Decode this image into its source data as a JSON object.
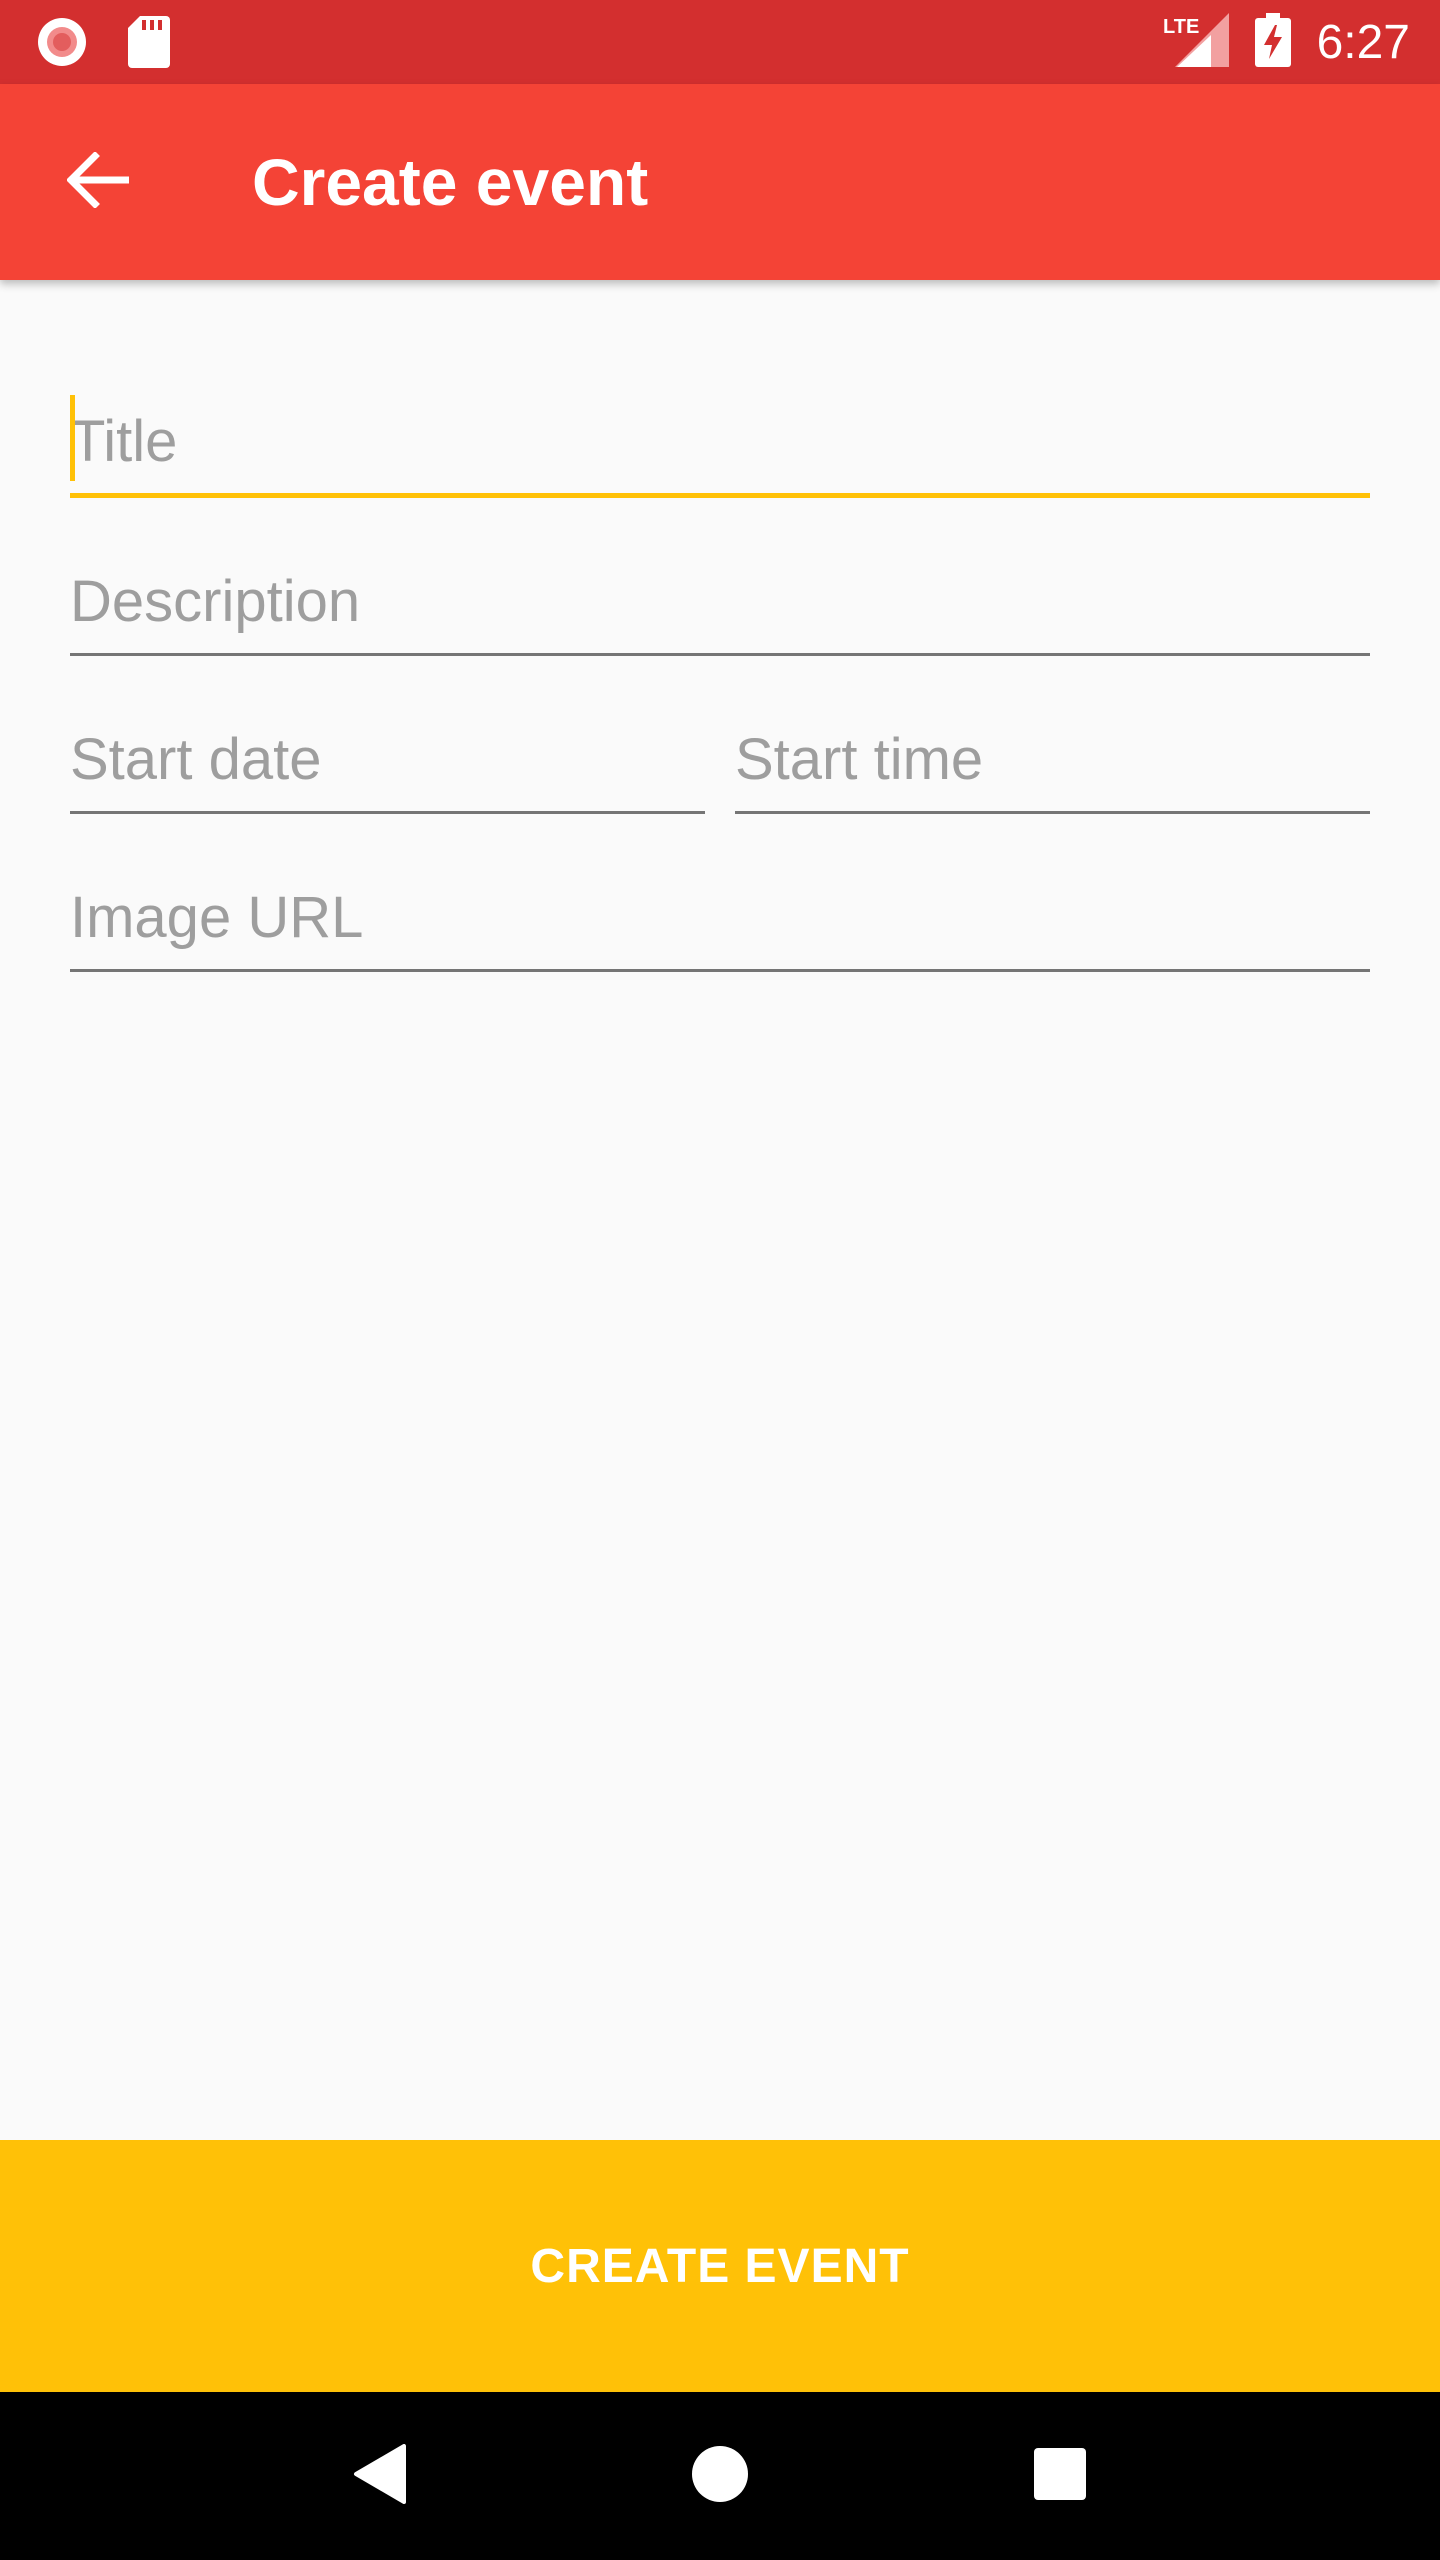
{
  "status_bar": {
    "time": "6:27",
    "network": "LTE",
    "left_icons": [
      "record-icon",
      "sd-card-icon"
    ],
    "right_icons": [
      "lte-signal-icon",
      "battery-charging-icon"
    ]
  },
  "app_bar": {
    "title": "Create event",
    "back_icon": "arrow-back-icon",
    "color": "#f44336"
  },
  "form": {
    "title_placeholder": "Title",
    "description_placeholder": "Description",
    "start_date_placeholder": "Start date",
    "start_time_placeholder": "Start time",
    "image_url_placeholder": "Image URL",
    "focused_field": "Title",
    "accent_color": "#ffc107"
  },
  "cta": {
    "label": "CREATE EVENT",
    "color": "#ffc107"
  },
  "nav_bar": {
    "icons": [
      "nav-back-icon",
      "nav-home-icon",
      "nav-recents-icon"
    ]
  }
}
